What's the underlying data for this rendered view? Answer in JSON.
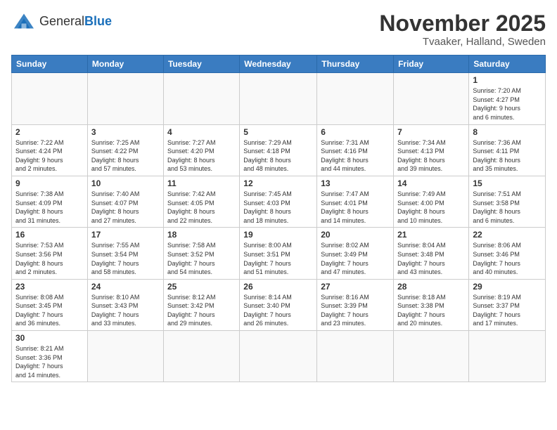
{
  "logo": {
    "text_general": "General",
    "text_blue": "Blue"
  },
  "header": {
    "month": "November 2025",
    "location": "Tvaaker, Halland, Sweden"
  },
  "weekdays": [
    "Sunday",
    "Monday",
    "Tuesday",
    "Wednesday",
    "Thursday",
    "Friday",
    "Saturday"
  ],
  "days": {
    "d1": {
      "n": "1",
      "info": "Sunrise: 7:20 AM\nSunset: 4:27 PM\nDaylight: 9 hours\nand 6 minutes."
    },
    "d2": {
      "n": "2",
      "info": "Sunrise: 7:22 AM\nSunset: 4:24 PM\nDaylight: 9 hours\nand 2 minutes."
    },
    "d3": {
      "n": "3",
      "info": "Sunrise: 7:25 AM\nSunset: 4:22 PM\nDaylight: 8 hours\nand 57 minutes."
    },
    "d4": {
      "n": "4",
      "info": "Sunrise: 7:27 AM\nSunset: 4:20 PM\nDaylight: 8 hours\nand 53 minutes."
    },
    "d5": {
      "n": "5",
      "info": "Sunrise: 7:29 AM\nSunset: 4:18 PM\nDaylight: 8 hours\nand 48 minutes."
    },
    "d6": {
      "n": "6",
      "info": "Sunrise: 7:31 AM\nSunset: 4:16 PM\nDaylight: 8 hours\nand 44 minutes."
    },
    "d7": {
      "n": "7",
      "info": "Sunrise: 7:34 AM\nSunset: 4:13 PM\nDaylight: 8 hours\nand 39 minutes."
    },
    "d8": {
      "n": "8",
      "info": "Sunrise: 7:36 AM\nSunset: 4:11 PM\nDaylight: 8 hours\nand 35 minutes."
    },
    "d9": {
      "n": "9",
      "info": "Sunrise: 7:38 AM\nSunset: 4:09 PM\nDaylight: 8 hours\nand 31 minutes."
    },
    "d10": {
      "n": "10",
      "info": "Sunrise: 7:40 AM\nSunset: 4:07 PM\nDaylight: 8 hours\nand 27 minutes."
    },
    "d11": {
      "n": "11",
      "info": "Sunrise: 7:42 AM\nSunset: 4:05 PM\nDaylight: 8 hours\nand 22 minutes."
    },
    "d12": {
      "n": "12",
      "info": "Sunrise: 7:45 AM\nSunset: 4:03 PM\nDaylight: 8 hours\nand 18 minutes."
    },
    "d13": {
      "n": "13",
      "info": "Sunrise: 7:47 AM\nSunset: 4:01 PM\nDaylight: 8 hours\nand 14 minutes."
    },
    "d14": {
      "n": "14",
      "info": "Sunrise: 7:49 AM\nSunset: 4:00 PM\nDaylight: 8 hours\nand 10 minutes."
    },
    "d15": {
      "n": "15",
      "info": "Sunrise: 7:51 AM\nSunset: 3:58 PM\nDaylight: 8 hours\nand 6 minutes."
    },
    "d16": {
      "n": "16",
      "info": "Sunrise: 7:53 AM\nSunset: 3:56 PM\nDaylight: 8 hours\nand 2 minutes."
    },
    "d17": {
      "n": "17",
      "info": "Sunrise: 7:55 AM\nSunset: 3:54 PM\nDaylight: 7 hours\nand 58 minutes."
    },
    "d18": {
      "n": "18",
      "info": "Sunrise: 7:58 AM\nSunset: 3:52 PM\nDaylight: 7 hours\nand 54 minutes."
    },
    "d19": {
      "n": "19",
      "info": "Sunrise: 8:00 AM\nSunset: 3:51 PM\nDaylight: 7 hours\nand 51 minutes."
    },
    "d20": {
      "n": "20",
      "info": "Sunrise: 8:02 AM\nSunset: 3:49 PM\nDaylight: 7 hours\nand 47 minutes."
    },
    "d21": {
      "n": "21",
      "info": "Sunrise: 8:04 AM\nSunset: 3:48 PM\nDaylight: 7 hours\nand 43 minutes."
    },
    "d22": {
      "n": "22",
      "info": "Sunrise: 8:06 AM\nSunset: 3:46 PM\nDaylight: 7 hours\nand 40 minutes."
    },
    "d23": {
      "n": "23",
      "info": "Sunrise: 8:08 AM\nSunset: 3:45 PM\nDaylight: 7 hours\nand 36 minutes."
    },
    "d24": {
      "n": "24",
      "info": "Sunrise: 8:10 AM\nSunset: 3:43 PM\nDaylight: 7 hours\nand 33 minutes."
    },
    "d25": {
      "n": "25",
      "info": "Sunrise: 8:12 AM\nSunset: 3:42 PM\nDaylight: 7 hours\nand 29 minutes."
    },
    "d26": {
      "n": "26",
      "info": "Sunrise: 8:14 AM\nSunset: 3:40 PM\nDaylight: 7 hours\nand 26 minutes."
    },
    "d27": {
      "n": "27",
      "info": "Sunrise: 8:16 AM\nSunset: 3:39 PM\nDaylight: 7 hours\nand 23 minutes."
    },
    "d28": {
      "n": "28",
      "info": "Sunrise: 8:18 AM\nSunset: 3:38 PM\nDaylight: 7 hours\nand 20 minutes."
    },
    "d29": {
      "n": "29",
      "info": "Sunrise: 8:19 AM\nSunset: 3:37 PM\nDaylight: 7 hours\nand 17 minutes."
    },
    "d30": {
      "n": "30",
      "info": "Sunrise: 8:21 AM\nSunset: 3:36 PM\nDaylight: 7 hours\nand 14 minutes."
    }
  }
}
